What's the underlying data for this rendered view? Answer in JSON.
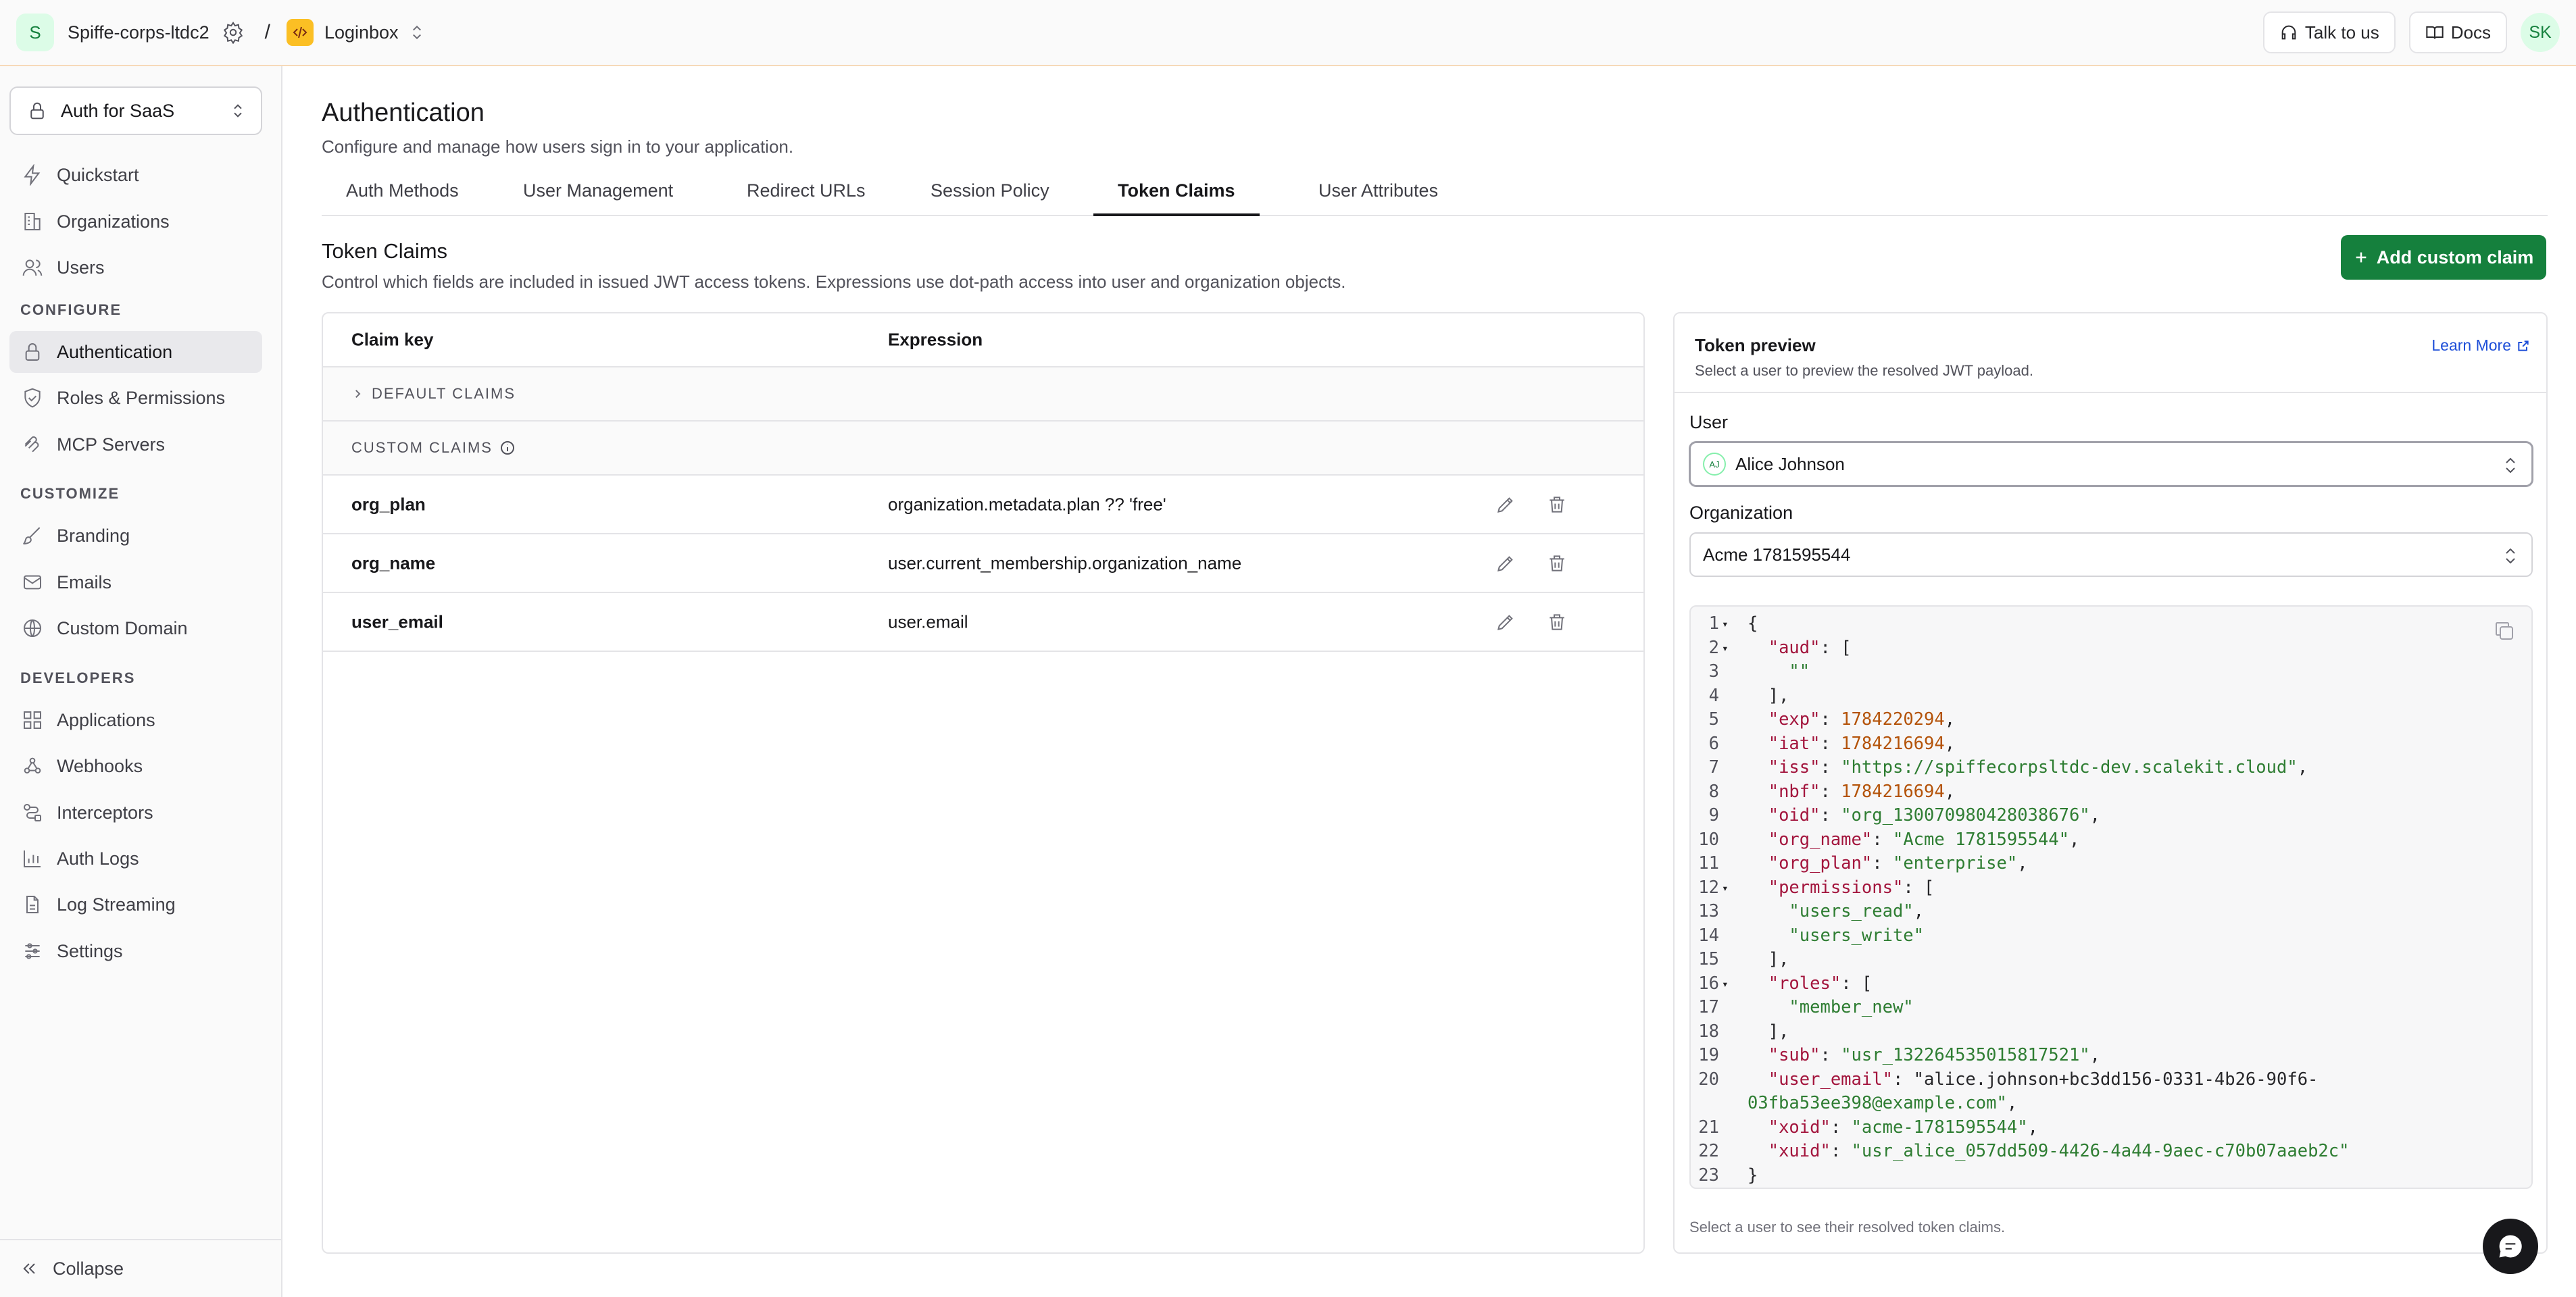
{
  "topbar": {
    "org_initial": "S",
    "org_name": "Spiffe-corps-ltdc2",
    "separator": "/",
    "env_name": "Loginbox",
    "talk_label": "Talk to us",
    "docs_label": "Docs",
    "user_initials": "SK"
  },
  "sidebar": {
    "app_select": "Auth for SaaS",
    "items": [
      {
        "label": "Quickstart"
      },
      {
        "label": "Organizations"
      },
      {
        "label": "Users"
      }
    ],
    "sections": {
      "configure": "CONFIGURE",
      "customize": "CUSTOMIZE",
      "developers": "DEVELOPERS"
    },
    "configure_items": [
      {
        "label": "Authentication"
      },
      {
        "label": "Roles & Permissions"
      },
      {
        "label": "MCP Servers"
      }
    ],
    "customize_items": [
      {
        "label": "Branding"
      },
      {
        "label": "Emails"
      },
      {
        "label": "Custom Domain"
      }
    ],
    "developer_items": [
      {
        "label": "Applications"
      },
      {
        "label": "Webhooks"
      },
      {
        "label": "Interceptors"
      },
      {
        "label": "Auth Logs"
      },
      {
        "label": "Log Streaming"
      },
      {
        "label": "Settings"
      }
    ],
    "collapse_label": "Collapse"
  },
  "page": {
    "title": "Authentication",
    "subtitle": "Configure and manage how users sign in to your application.",
    "tabs": [
      "Auth Methods",
      "User Management",
      "Redirect URLs",
      "Session Policy",
      "Token Claims",
      "User Attributes"
    ],
    "active_tab": "Token Claims"
  },
  "claims": {
    "title": "Token Claims",
    "description": "Control which fields are included in issued JWT access tokens. Expressions use dot-path access into user and organization objects.",
    "add_label": "Add custom claim",
    "col_key": "Claim key",
    "col_expr": "Expression",
    "default_group": "DEFAULT CLAIMS",
    "custom_group": "CUSTOM CLAIMS",
    "rows": [
      {
        "key": "org_plan",
        "expression": "organization.metadata.plan ?? 'free'"
      },
      {
        "key": "org_name",
        "expression": "user.current_membership.organization_name"
      },
      {
        "key": "user_email",
        "expression": "user.email"
      }
    ]
  },
  "preview": {
    "title": "Token preview",
    "subtitle": "Select a user to preview the resolved JWT payload.",
    "learn_more": "Learn More",
    "user_label": "User",
    "user_initials": "AJ",
    "user_value": "Alice Johnson",
    "org_label": "Organization",
    "org_value": "Acme 1781595544",
    "footer": "Select a user to see their resolved token claims.",
    "json_lines": [
      {
        "n": "1",
        "fold": true,
        "text": "{"
      },
      {
        "n": "2",
        "fold": true,
        "text": "  \"aud\": ["
      },
      {
        "n": "3",
        "fold": false,
        "text": "    \"\""
      },
      {
        "n": "4",
        "fold": false,
        "text": "  ],"
      },
      {
        "n": "5",
        "fold": false,
        "text": "  \"exp\": 1784220294,"
      },
      {
        "n": "6",
        "fold": false,
        "text": "  \"iat\": 1784216694,"
      },
      {
        "n": "7",
        "fold": false,
        "text": "  \"iss\": \"https://spiffecorpsltdc-dev.scalekit.cloud\","
      },
      {
        "n": "8",
        "fold": false,
        "text": "  \"nbf\": 1784216694,"
      },
      {
        "n": "9",
        "fold": false,
        "text": "  \"oid\": \"org_130070980428038676\","
      },
      {
        "n": "10",
        "fold": false,
        "text": "  \"org_name\": \"Acme 1781595544\","
      },
      {
        "n": "11",
        "fold": false,
        "text": "  \"org_plan\": \"enterprise\","
      },
      {
        "n": "12",
        "fold": true,
        "text": "  \"permissions\": ["
      },
      {
        "n": "13",
        "fold": false,
        "text": "    \"users_read\","
      },
      {
        "n": "14",
        "fold": false,
        "text": "    \"users_write\""
      },
      {
        "n": "15",
        "fold": false,
        "text": "  ],"
      },
      {
        "n": "16",
        "fold": true,
        "text": "  \"roles\": ["
      },
      {
        "n": "17",
        "fold": false,
        "text": "    \"member_new\""
      },
      {
        "n": "18",
        "fold": false,
        "text": "  ],"
      },
      {
        "n": "19",
        "fold": false,
        "text": "  \"sub\": \"usr_132264535015817521\","
      },
      {
        "n": "20",
        "fold": false,
        "text": "  \"user_email\": \"alice.johnson+bc3dd156-0331-4b26-90f6-"
      },
      {
        "n": "",
        "fold": false,
        "text": "03fba53ee398@example.com\","
      },
      {
        "n": "21",
        "fold": false,
        "text": "  \"xoid\": \"acme-1781595544\","
      },
      {
        "n": "22",
        "fold": false,
        "text": "  \"xuid\": \"usr_alice_057dd509-4426-4a44-9aec-c70b07aaeb2c\""
      },
      {
        "n": "23",
        "fold": false,
        "text": "}"
      }
    ]
  },
  "colors": {
    "primary": "#15803d",
    "link": "#1d4ed8",
    "json_key": "#a3153d",
    "json_string": "#2e7d32",
    "json_number": "#b45309"
  }
}
